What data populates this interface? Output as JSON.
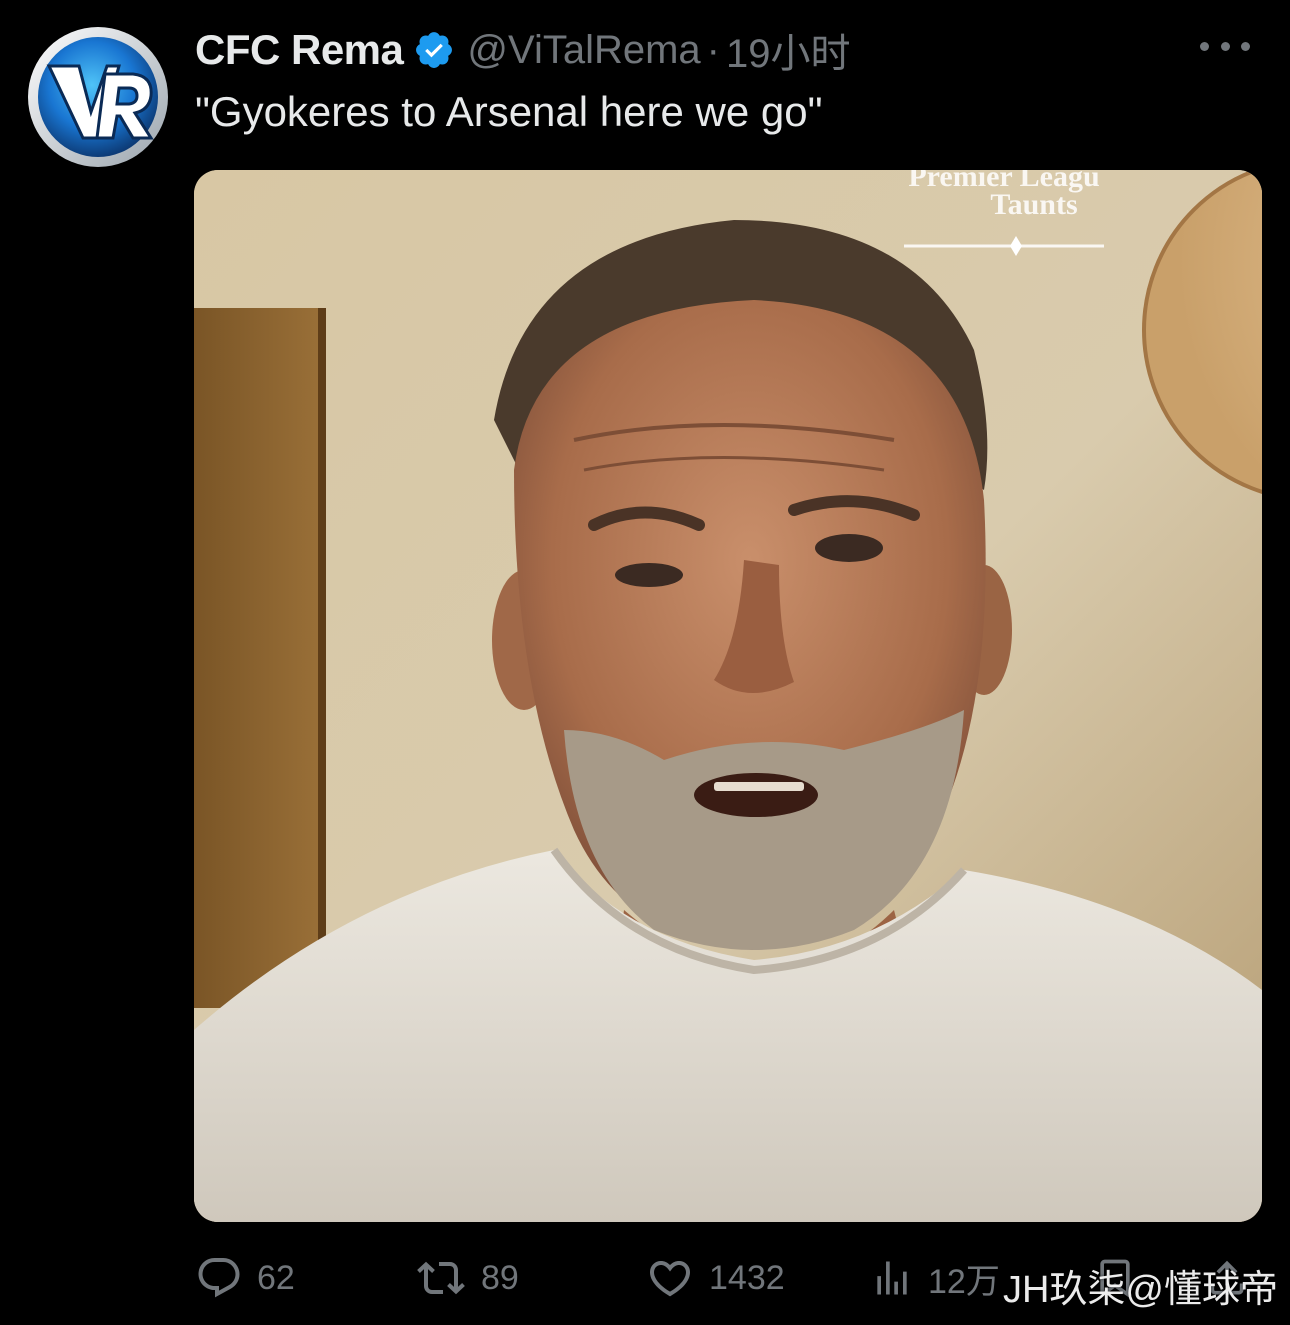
{
  "author": {
    "display_name": "CFC Rema",
    "handle": "@ViTalRema",
    "separator": "·",
    "time": "19小时",
    "verified": true,
    "avatar_icon": "vr-logo-avatar"
  },
  "tweet": {
    "text": "\"Gyokeres to Arsenal here we go\""
  },
  "media": {
    "type": "photo",
    "overlay_title": "Taunts",
    "overlay_top_partial": "Premier Leagu"
  },
  "actions": {
    "reply": {
      "icon": "reply-icon",
      "count": "62"
    },
    "retweet": {
      "icon": "retweet-icon",
      "count": "89"
    },
    "like": {
      "icon": "heart-icon",
      "count": "1432"
    },
    "views": {
      "icon": "views-icon",
      "count": "12万"
    }
  },
  "watermark": "JH玖柒@懂球帝",
  "colors": {
    "background": "#000000",
    "primary_text": "#e7e9ea",
    "secondary_text": "#71767b",
    "verified_blue": "#1d9bf0"
  }
}
